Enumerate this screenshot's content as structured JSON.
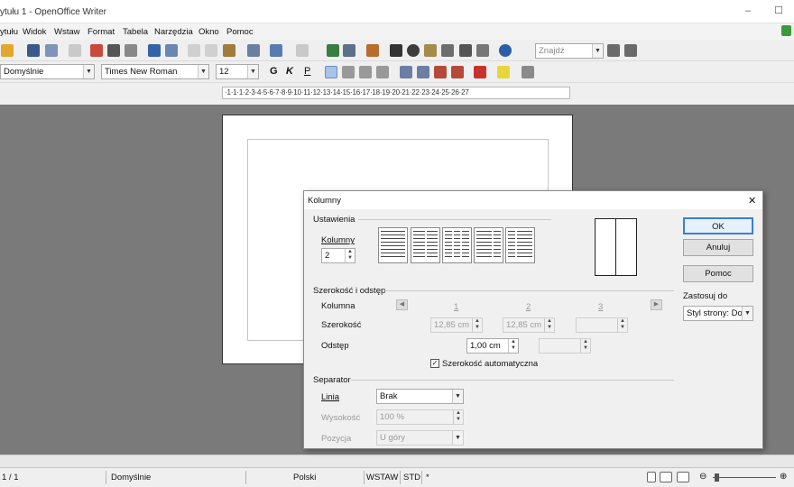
{
  "window": {
    "title": "ytułu 1 - OpenOffice Writer",
    "minimize": "–",
    "maximize": "☐"
  },
  "menu": [
    "ytułu",
    "Widok",
    "Wstaw",
    "Format",
    "Tabela",
    "Narzędzia",
    "Okno",
    "Pomoc"
  ],
  "toolbar": {
    "find_placeholder": "Znajdź"
  },
  "formatting": {
    "style": "Domyślnie",
    "font": "Times New Roman",
    "size": "12",
    "bold": "G",
    "italic": "K",
    "underline": "P"
  },
  "ruler": "·1·1·1·2·3·4·5·6·7·8·9·10·11·12·13·14·15·16·17·18·19·20·21·22·23·24·25·26·27",
  "status": {
    "page": "1 / 1",
    "style": "Domyślnie",
    "language": "Polski",
    "insert_mode": "WSTAW",
    "selection_mode": "STD",
    "modified": "*"
  },
  "dialog": {
    "title": "Kolumny",
    "close": "✕",
    "settings": {
      "heading": "Ustawienia",
      "columns_label": "Kolumny",
      "columns_value": "2"
    },
    "width_spacing": {
      "heading": "Szerokość i odstęp",
      "column_label": "Kolumna",
      "col_numbers": [
        "1",
        "2",
        "3"
      ],
      "width_label": "Szerokość",
      "width_values": [
        "12,85 cm",
        "12,85 cm",
        ""
      ],
      "spacing_label": "Odstęp",
      "spacing_values": [
        "1,00 cm",
        ""
      ],
      "autowidth_label": "Szerokość automatyczna",
      "autowidth_checked": true
    },
    "separator": {
      "heading": "Separator",
      "line_label": "Linia",
      "line_value": "Brak",
      "height_label": "Wysokość",
      "height_value": "100 %",
      "position_label": "Pozycja",
      "position_value": "U góry"
    },
    "buttons": {
      "ok": "OK",
      "cancel": "Anuluj",
      "help": "Pomoc"
    },
    "apply_to": {
      "label": "Zastosuj do",
      "value": "Styl strony: Domyślnie"
    }
  }
}
